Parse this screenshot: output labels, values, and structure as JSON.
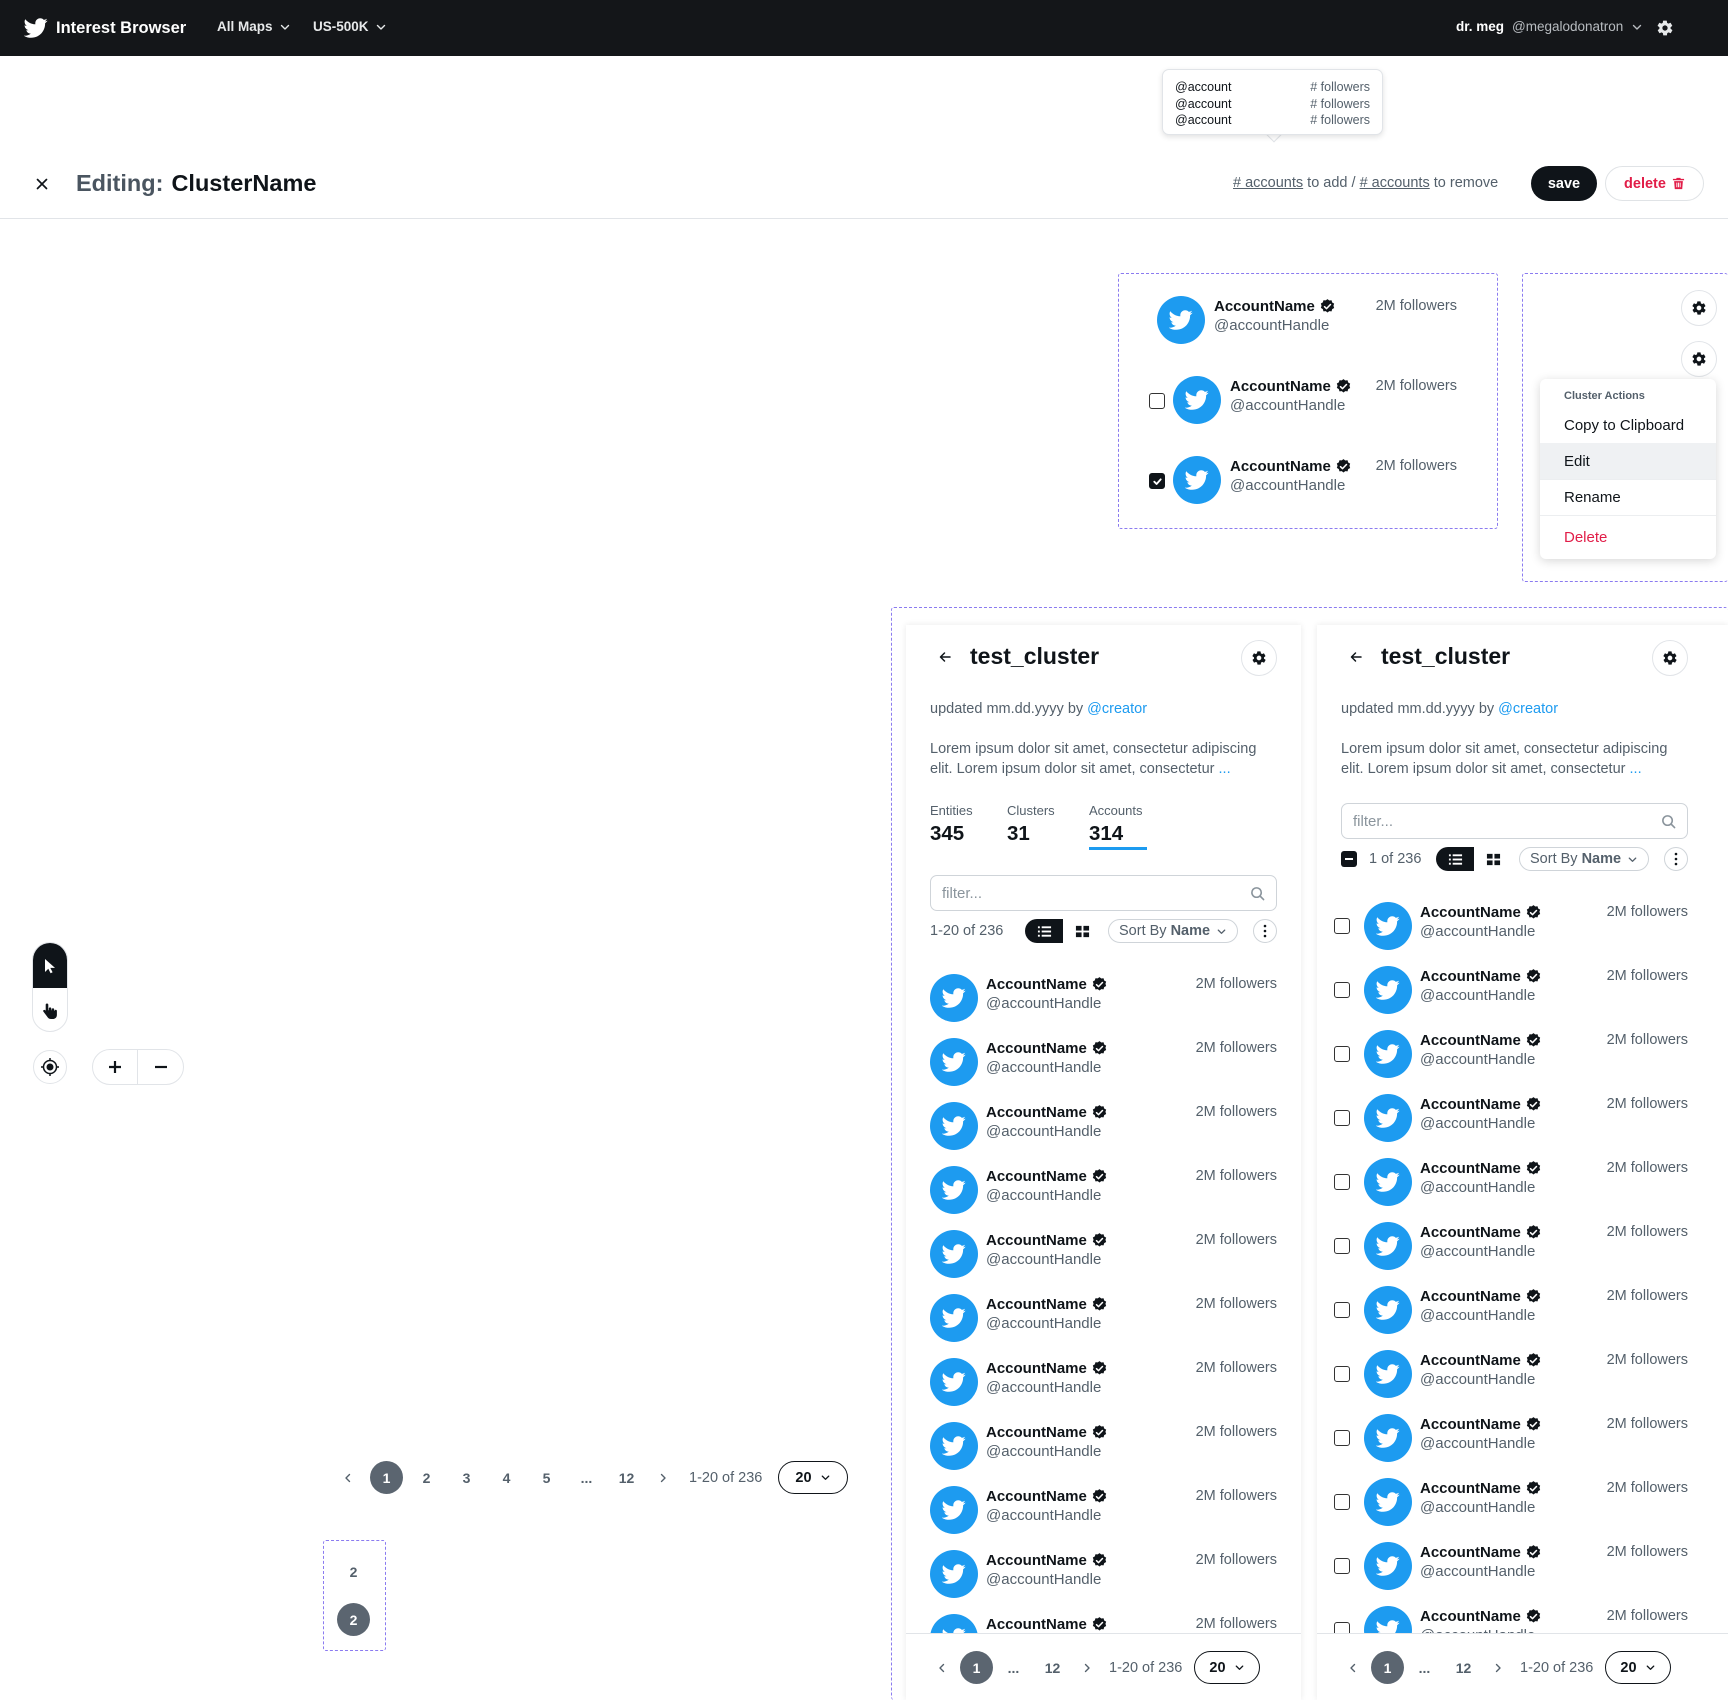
{
  "topbar": {
    "app_title": "Interest Browser",
    "maps_dropdown": "All Maps",
    "dataset_dropdown": "US-500K",
    "user_name": "dr. meg",
    "user_handle": "@megalodonatron"
  },
  "tooltip": {
    "rows": [
      {
        "account": "@account",
        "followers": "# followers"
      },
      {
        "account": "@account",
        "followers": "# followers"
      },
      {
        "account": "@account",
        "followers": "# followers"
      }
    ]
  },
  "editor": {
    "label": "Editing:",
    "cluster_name": "ClusterName",
    "accounts_link_1": "# accounts",
    "to_add": " to add / ",
    "accounts_link_2": "# accounts",
    "to_remove": " to remove",
    "save_label": "save",
    "delete_label": "delete"
  },
  "account_states": {
    "rows": [
      {
        "name": "AccountName",
        "handle": "@accountHandle",
        "followers": "2M followers",
        "checkbox": "none"
      },
      {
        "name": "AccountName",
        "handle": "@accountHandle",
        "followers": "2M followers",
        "checkbox": "unchecked"
      },
      {
        "name": "AccountName",
        "handle": "@accountHandle",
        "followers": "2M followers",
        "checkbox": "checked"
      }
    ]
  },
  "cluster_menu": {
    "header": "Cluster Actions",
    "items": [
      "Copy to Clipboard",
      "Edit",
      "Rename",
      "Delete"
    ]
  },
  "panel_left": {
    "title": "test_cluster",
    "updated": "updated mm.dd.yyyy by ",
    "creator": "@creator",
    "description": "Lorem ipsum dolor sit amet, consectetur adipiscing elit. Lorem ipsum dolor sit amet, consectetur ",
    "more": "...",
    "stats": [
      {
        "label": "Entities",
        "value": "345"
      },
      {
        "label": "Clusters",
        "value": "31"
      },
      {
        "label": "Accounts",
        "value": "314"
      }
    ],
    "filter_placeholder": "filter...",
    "range": "1-20 of 236",
    "sort_prefix": "Sort By ",
    "sort_field": "Name",
    "row_name": "AccountName",
    "row_handle": "@accountHandle",
    "row_followers": "2M followers",
    "pager": {
      "current": "1",
      "ellipsis": "...",
      "last": "12",
      "range": "1-20 of 236",
      "size": "20"
    }
  },
  "panel_right": {
    "title": "test_cluster",
    "updated": "updated mm.dd.yyyy by ",
    "creator": "@creator",
    "description": "Lorem ipsum dolor sit amet, consectetur adipiscing elit. Lorem ipsum dolor sit amet, consectetur ",
    "more": "...",
    "filter_placeholder": "filter...",
    "selection": "1 of 236",
    "sort_prefix": "Sort By ",
    "sort_field": "Name",
    "row_name": "AccountName",
    "row_handle": "@accountHandle",
    "row_followers": "2M followers",
    "pager": {
      "current": "1",
      "ellipsis": "...",
      "last": "12",
      "range": "1-20 of 236",
      "size": "20"
    }
  },
  "main_pager": {
    "pages": [
      "1",
      "2",
      "3",
      "4",
      "5",
      "...",
      "12"
    ],
    "range": "1-20 of 236",
    "size": "20"
  },
  "page_states": [
    "2",
    "2"
  ],
  "colors": {
    "topbar": "#141619",
    "twitter_blue": "#1d9bf0",
    "danger": "#e11d48",
    "dashed_outline": "#8b7bf0",
    "accent_underline": "#1d9bf0"
  }
}
